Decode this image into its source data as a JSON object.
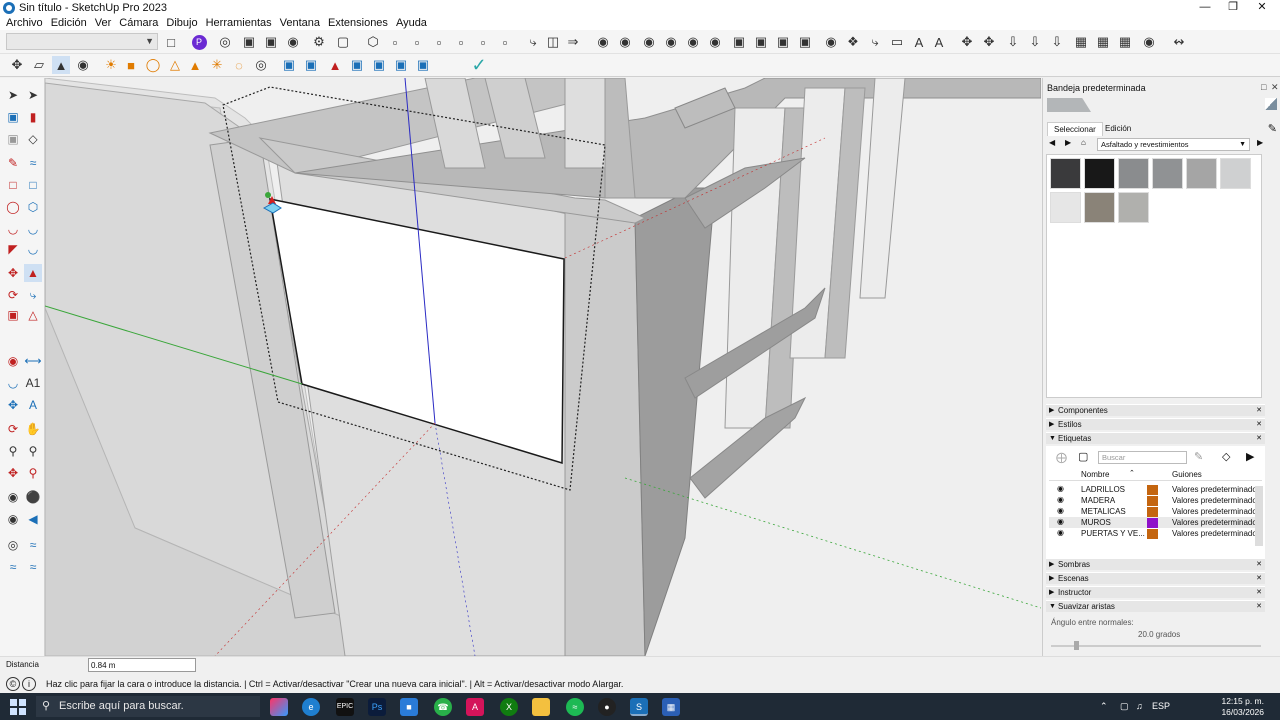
{
  "window": {
    "title": "Sin título - SketchUp Pro 2023",
    "controls": [
      "minimize",
      "maximize",
      "close"
    ]
  },
  "menu": [
    "Archivo",
    "Edición",
    "Ver",
    "Cámara",
    "Dibujo",
    "Herramientas",
    "Ventana",
    "Extensiones",
    "Ayuda"
  ],
  "colors": {
    "accent": "#1b6fb7",
    "axis_green": "#3aa63a",
    "axis_blue": "#2b2bc4",
    "selection_dotted": "#222222",
    "tag_ladrillos": "#c4650f",
    "tag_madera": "#c4650f",
    "tag_metalicas": "#c4650f",
    "tag_muros": "#8f11c9",
    "tag_puertas": "#c4650f"
  },
  "tray": {
    "title": "Bandeja predeterminada",
    "materials": {
      "tabs": [
        "Seleccionar",
        "Edición"
      ],
      "active_tab": "Seleccionar",
      "library": "Asfaltado y revestimientos",
      "swatches": [
        "#3a3a3c",
        "#181818",
        "#8a8c8e",
        "#909294",
        "#a5a5a5",
        "#cfd0d1",
        "#e6e6e6",
        "#8a8378",
        "#b0b0ad"
      ]
    },
    "panels": {
      "componentes": "Componentes",
      "estilos": "Estilos",
      "etiquetas": "Etiquetas",
      "sombras": "Sombras",
      "escenas": "Escenas",
      "instructor": "Instructor",
      "suavizar": "Suavizar aristas"
    },
    "tags": {
      "search_placeholder": "Buscar",
      "col_name": "Nombre",
      "col_dash": "Guiones",
      "rows": [
        {
          "name": "LADRILLOS",
          "dash": "Valores predeterminados"
        },
        {
          "name": "MADERA",
          "dash": "Valores predeterminados"
        },
        {
          "name": "METALICAS",
          "dash": "Valores predeterminados"
        },
        {
          "name": "MUROS",
          "dash": "Valores predeterminados"
        },
        {
          "name": "PUERTAS Y VE...",
          "dash": "Valores predeterminados"
        }
      ]
    },
    "smooth": {
      "label": "Ángulo entre normales:",
      "value": "20.0  grados"
    }
  },
  "measurements": {
    "label": "Distancia",
    "value": "0.84 m"
  },
  "status": {
    "hint": "Haz clic para fijar la cara o introduce la distancia. | Ctrl = Activar/desactivar \"Crear una nueva cara inicial\". | Alt = Activar/desactivar modo Alargar."
  },
  "taskbar": {
    "search_placeholder": "Escribe aquí para buscar.",
    "lang": "ESP",
    "time": "12:15 p. m.",
    "date": "16/03/2026"
  }
}
